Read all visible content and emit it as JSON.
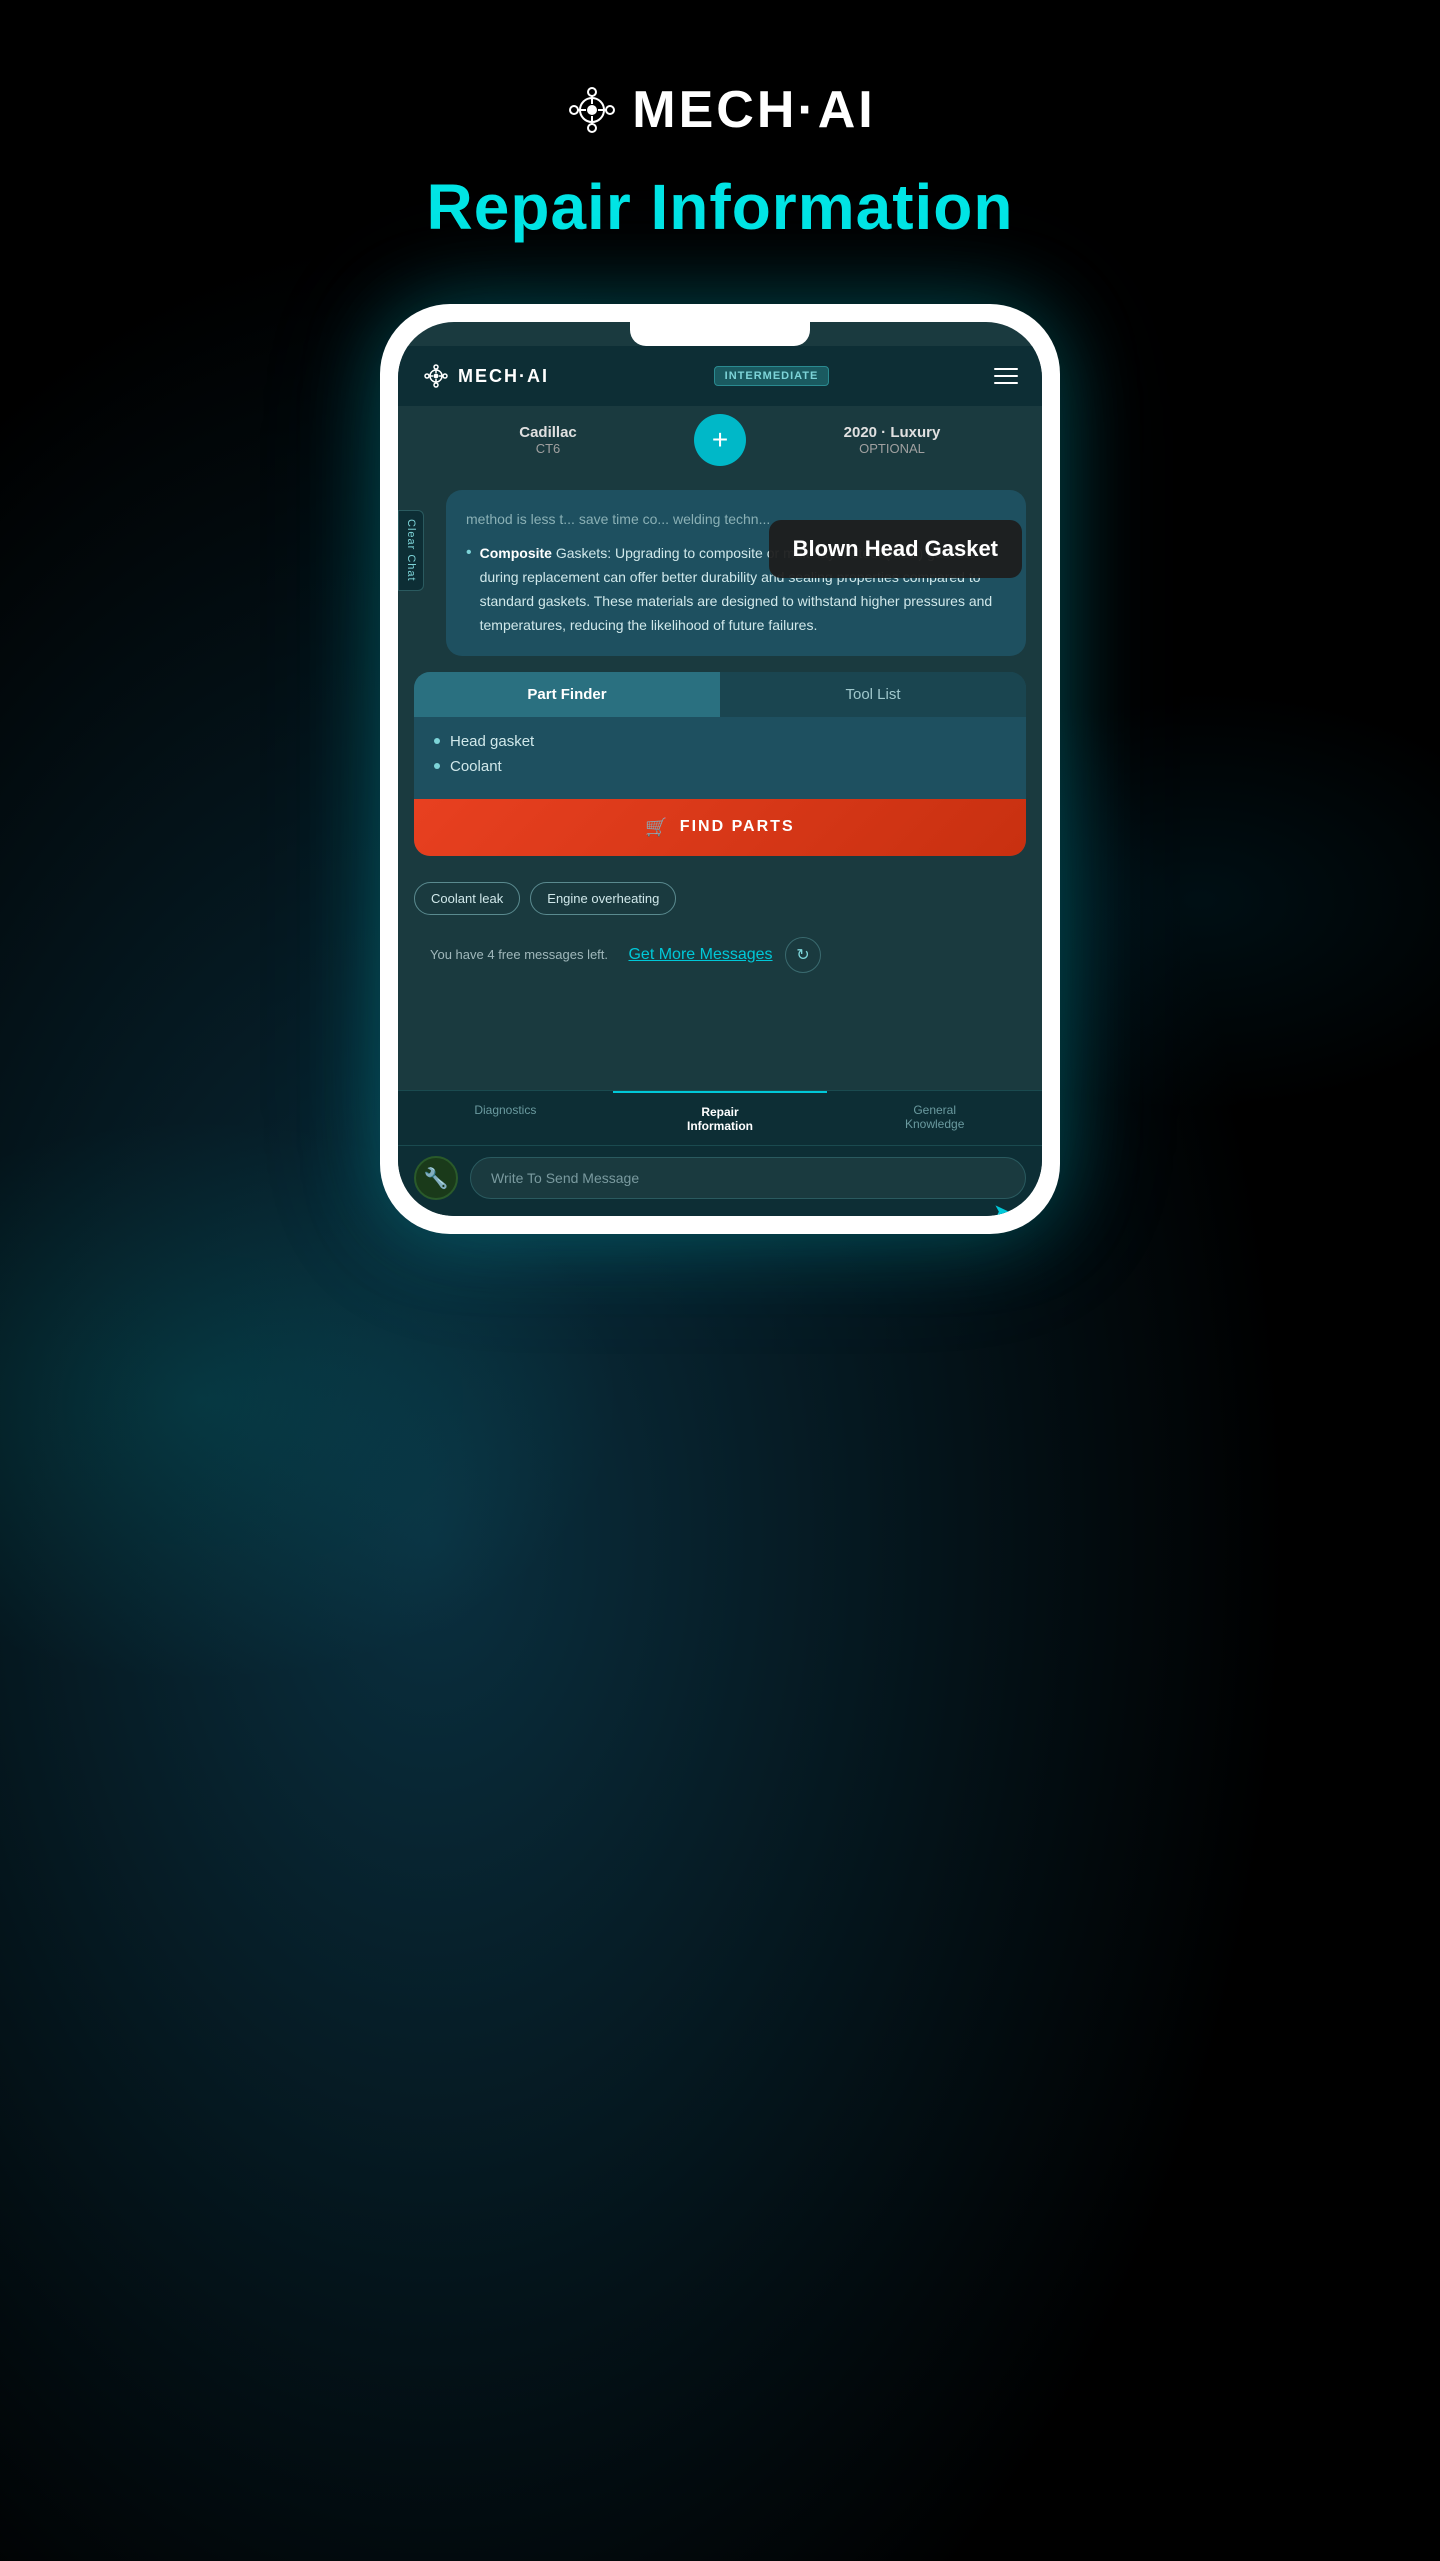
{
  "app": {
    "name": "MECH·AI",
    "page_title": "Repair Information",
    "logo_alt": "MECH-AI Logo"
  },
  "header": {
    "badge": "INTERMEDIATE",
    "hamburger_label": "Menu"
  },
  "vehicle": {
    "make": "Cadillac",
    "model": "CT6",
    "year": "2020 · Luxury",
    "trim": "OPTIONAL",
    "add_label": "+"
  },
  "chat": {
    "clear_label": "Clear Chat",
    "tooltip": "Blown Head Gasket",
    "message_text_partial": "method is less t... save time co... welding techn...",
    "bullet_bold": "Composite",
    "bullet_label": "Gaskets:",
    "bullet_body": "Upgrading to composite or multi-layer steel (MLS) gaskets during replacement can offer better durability and sealing properties compared to standard gaskets. These materials are designed to withstand higher pressures and temperatures, reducing the likelihood of future failures."
  },
  "part_finder": {
    "tab_active": "Part Finder",
    "tab_inactive": "Tool List",
    "parts": [
      "Head gasket",
      "Coolant"
    ],
    "find_parts_label": "FIND PARTS"
  },
  "suggestions": [
    "Coolant leak",
    "Engine overheating"
  ],
  "free_messages": {
    "text": "You have 4 free messages left.",
    "link_text": "Get More Messages"
  },
  "bottom_nav": [
    {
      "label": "Diagnostics",
      "active": false
    },
    {
      "label": "Repair\nInformation",
      "active": true
    },
    {
      "label": "General\nKnowledge",
      "active": false
    }
  ],
  "message_input": {
    "placeholder": "Write To Send Message",
    "send_icon": "➤"
  },
  "obd_icon": "🔧"
}
